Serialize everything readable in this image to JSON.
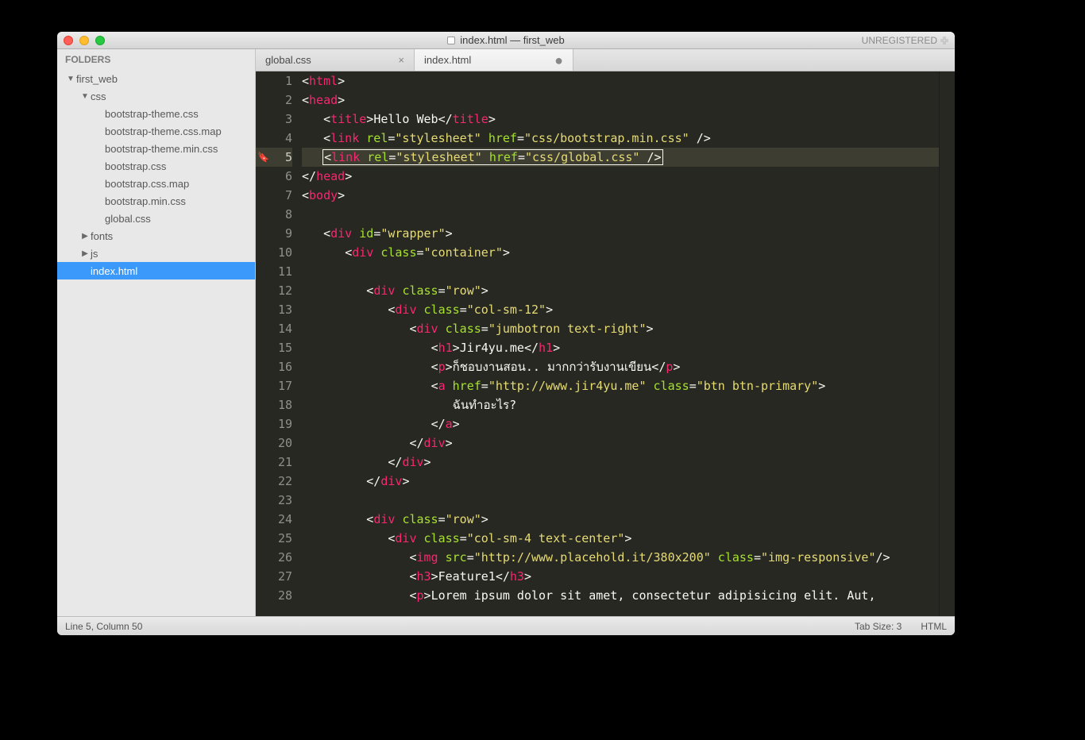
{
  "window": {
    "title": "index.html — first_web",
    "unregistered": "UNREGISTERED"
  },
  "sidebar": {
    "heading": "FOLDERS",
    "tree": [
      {
        "label": "first_web",
        "depth": 0,
        "arrow": "down",
        "sel": false
      },
      {
        "label": "css",
        "depth": 1,
        "arrow": "down",
        "sel": false
      },
      {
        "label": "bootstrap-theme.css",
        "depth": 2,
        "arrow": "",
        "sel": false
      },
      {
        "label": "bootstrap-theme.css.map",
        "depth": 2,
        "arrow": "",
        "sel": false
      },
      {
        "label": "bootstrap-theme.min.css",
        "depth": 2,
        "arrow": "",
        "sel": false
      },
      {
        "label": "bootstrap.css",
        "depth": 2,
        "arrow": "",
        "sel": false
      },
      {
        "label": "bootstrap.css.map",
        "depth": 2,
        "arrow": "",
        "sel": false
      },
      {
        "label": "bootstrap.min.css",
        "depth": 2,
        "arrow": "",
        "sel": false
      },
      {
        "label": "global.css",
        "depth": 2,
        "arrow": "",
        "sel": false
      },
      {
        "label": "fonts",
        "depth": 1,
        "arrow": "right",
        "sel": false
      },
      {
        "label": "js",
        "depth": 1,
        "arrow": "right",
        "sel": false
      },
      {
        "label": "index.html",
        "depth": 1,
        "arrow": "",
        "sel": true
      }
    ]
  },
  "tabs": [
    {
      "label": "global.css",
      "active": false,
      "modified": false
    },
    {
      "label": "index.html",
      "active": true,
      "modified": true
    }
  ],
  "code": {
    "highlighted_line": 5,
    "lines": [
      {
        "n": 1,
        "ind": 0,
        "tokens": [
          [
            "ang",
            "<"
          ],
          [
            "tag",
            "html"
          ],
          [
            "ang",
            ">"
          ]
        ]
      },
      {
        "n": 2,
        "ind": 0,
        "tokens": [
          [
            "ang",
            "<"
          ],
          [
            "tag",
            "head"
          ],
          [
            "ang",
            ">"
          ]
        ]
      },
      {
        "n": 3,
        "ind": 1,
        "tokens": [
          [
            "ang",
            "<"
          ],
          [
            "tag",
            "title"
          ],
          [
            "ang",
            ">"
          ],
          [
            "txt",
            "Hello Web"
          ],
          [
            "ang",
            "</"
          ],
          [
            "tag",
            "title"
          ],
          [
            "ang",
            ">"
          ]
        ]
      },
      {
        "n": 4,
        "ind": 1,
        "tokens": [
          [
            "ang",
            "<"
          ],
          [
            "tag",
            "link"
          ],
          [
            "txt",
            " "
          ],
          [
            "attr",
            "rel"
          ],
          [
            "punc",
            "="
          ],
          [
            "str",
            "\"stylesheet\""
          ],
          [
            "txt",
            " "
          ],
          [
            "attr",
            "href"
          ],
          [
            "punc",
            "="
          ],
          [
            "str",
            "\"css/bootstrap.min.css\""
          ],
          [
            "txt",
            " "
          ],
          [
            "ang",
            "/>"
          ]
        ]
      },
      {
        "n": 5,
        "ind": 1,
        "hl": true,
        "sel": true,
        "tokens": [
          [
            "ang",
            "<"
          ],
          [
            "tag",
            "link"
          ],
          [
            "txt",
            " "
          ],
          [
            "attr",
            "rel"
          ],
          [
            "punc",
            "="
          ],
          [
            "str",
            "\"stylesheet\""
          ],
          [
            "txt",
            " "
          ],
          [
            "attr",
            "href"
          ],
          [
            "punc",
            "="
          ],
          [
            "str",
            "\"css/global.css\""
          ],
          [
            "txt",
            " "
          ],
          [
            "ang",
            "/>"
          ]
        ]
      },
      {
        "n": 6,
        "ind": 0,
        "tokens": [
          [
            "ang",
            "</"
          ],
          [
            "tag",
            "head"
          ],
          [
            "ang",
            ">"
          ]
        ]
      },
      {
        "n": 7,
        "ind": 0,
        "tokens": [
          [
            "ang",
            "<"
          ],
          [
            "tag",
            "body"
          ],
          [
            "ang",
            ">"
          ]
        ]
      },
      {
        "n": 8,
        "ind": 0,
        "tokens": []
      },
      {
        "n": 9,
        "ind": 1,
        "tokens": [
          [
            "ang",
            "<"
          ],
          [
            "tag",
            "div"
          ],
          [
            "txt",
            " "
          ],
          [
            "attr",
            "id"
          ],
          [
            "punc",
            "="
          ],
          [
            "str",
            "\"wrapper\""
          ],
          [
            "ang",
            ">"
          ]
        ]
      },
      {
        "n": 10,
        "ind": 2,
        "tokens": [
          [
            "ang",
            "<"
          ],
          [
            "tag",
            "div"
          ],
          [
            "txt",
            " "
          ],
          [
            "attr",
            "class"
          ],
          [
            "punc",
            "="
          ],
          [
            "str",
            "\"container\""
          ],
          [
            "ang",
            ">"
          ]
        ]
      },
      {
        "n": 11,
        "ind": 0,
        "tokens": []
      },
      {
        "n": 12,
        "ind": 3,
        "tokens": [
          [
            "ang",
            "<"
          ],
          [
            "tag",
            "div"
          ],
          [
            "txt",
            " "
          ],
          [
            "attr",
            "class"
          ],
          [
            "punc",
            "="
          ],
          [
            "str",
            "\"row\""
          ],
          [
            "ang",
            ">"
          ]
        ]
      },
      {
        "n": 13,
        "ind": 4,
        "tokens": [
          [
            "ang",
            "<"
          ],
          [
            "tag",
            "div"
          ],
          [
            "txt",
            " "
          ],
          [
            "attr",
            "class"
          ],
          [
            "punc",
            "="
          ],
          [
            "str",
            "\"col-sm-12\""
          ],
          [
            "ang",
            ">"
          ]
        ]
      },
      {
        "n": 14,
        "ind": 5,
        "tokens": [
          [
            "ang",
            "<"
          ],
          [
            "tag",
            "div"
          ],
          [
            "txt",
            " "
          ],
          [
            "attr",
            "class"
          ],
          [
            "punc",
            "="
          ],
          [
            "str",
            "\"jumbotron text-right\""
          ],
          [
            "ang",
            ">"
          ]
        ]
      },
      {
        "n": 15,
        "ind": 6,
        "tokens": [
          [
            "ang",
            "<"
          ],
          [
            "tag",
            "h1"
          ],
          [
            "ang",
            ">"
          ],
          [
            "txt",
            "Jir4yu.me"
          ],
          [
            "ang",
            "</"
          ],
          [
            "tag",
            "h1"
          ],
          [
            "ang",
            ">"
          ]
        ]
      },
      {
        "n": 16,
        "ind": 6,
        "tokens": [
          [
            "ang",
            "<"
          ],
          [
            "tag",
            "p"
          ],
          [
            "ang",
            ">"
          ],
          [
            "txt",
            "ก็ชอบงานสอน.. มากกว่ารับงานเขียน"
          ],
          [
            "ang",
            "</"
          ],
          [
            "tag",
            "p"
          ],
          [
            "ang",
            ">"
          ]
        ]
      },
      {
        "n": 17,
        "ind": 6,
        "tokens": [
          [
            "ang",
            "<"
          ],
          [
            "tag",
            "a"
          ],
          [
            "txt",
            " "
          ],
          [
            "attr",
            "href"
          ],
          [
            "punc",
            "="
          ],
          [
            "str",
            "\"http://www.jir4yu.me\""
          ],
          [
            "txt",
            " "
          ],
          [
            "attr",
            "class"
          ],
          [
            "punc",
            "="
          ],
          [
            "str",
            "\"btn btn-primary\""
          ],
          [
            "ang",
            ">"
          ]
        ]
      },
      {
        "n": 18,
        "ind": 7,
        "tokens": [
          [
            "txt",
            "ฉันทำอะไร?"
          ]
        ]
      },
      {
        "n": 19,
        "ind": 6,
        "tokens": [
          [
            "ang",
            "</"
          ],
          [
            "tag",
            "a"
          ],
          [
            "ang",
            ">"
          ]
        ]
      },
      {
        "n": 20,
        "ind": 5,
        "tokens": [
          [
            "ang",
            "</"
          ],
          [
            "tag",
            "div"
          ],
          [
            "ang",
            ">"
          ]
        ]
      },
      {
        "n": 21,
        "ind": 4,
        "tokens": [
          [
            "ang",
            "</"
          ],
          [
            "tag",
            "div"
          ],
          [
            "ang",
            ">"
          ]
        ]
      },
      {
        "n": 22,
        "ind": 3,
        "tokens": [
          [
            "ang",
            "</"
          ],
          [
            "tag",
            "div"
          ],
          [
            "ang",
            ">"
          ]
        ]
      },
      {
        "n": 23,
        "ind": 0,
        "tokens": []
      },
      {
        "n": 24,
        "ind": 3,
        "tokens": [
          [
            "ang",
            "<"
          ],
          [
            "tag",
            "div"
          ],
          [
            "txt",
            " "
          ],
          [
            "attr",
            "class"
          ],
          [
            "punc",
            "="
          ],
          [
            "str",
            "\"row\""
          ],
          [
            "ang",
            ">"
          ]
        ]
      },
      {
        "n": 25,
        "ind": 4,
        "tokens": [
          [
            "ang",
            "<"
          ],
          [
            "tag",
            "div"
          ],
          [
            "txt",
            " "
          ],
          [
            "attr",
            "class"
          ],
          [
            "punc",
            "="
          ],
          [
            "str",
            "\"col-sm-4 text-center\""
          ],
          [
            "ang",
            ">"
          ]
        ]
      },
      {
        "n": 26,
        "ind": 5,
        "tokens": [
          [
            "ang",
            "<"
          ],
          [
            "tag",
            "img"
          ],
          [
            "txt",
            " "
          ],
          [
            "attr",
            "src"
          ],
          [
            "punc",
            "="
          ],
          [
            "str",
            "\"http://www.placehold.it/380x200\""
          ],
          [
            "txt",
            " "
          ],
          [
            "attr",
            "class"
          ],
          [
            "punc",
            "="
          ],
          [
            "str",
            "\"img-responsive\""
          ],
          [
            "ang",
            "/>"
          ]
        ]
      },
      {
        "n": 27,
        "ind": 5,
        "tokens": [
          [
            "ang",
            "<"
          ],
          [
            "tag",
            "h3"
          ],
          [
            "ang",
            ">"
          ],
          [
            "txt",
            "Feature1"
          ],
          [
            "ang",
            "</"
          ],
          [
            "tag",
            "h3"
          ],
          [
            "ang",
            ">"
          ]
        ]
      },
      {
        "n": 28,
        "ind": 5,
        "tokens": [
          [
            "ang",
            "<"
          ],
          [
            "tag",
            "p"
          ],
          [
            "ang",
            ">"
          ],
          [
            "txt",
            "Lorem ipsum dolor sit amet, consectetur adipisicing elit. Aut,"
          ]
        ]
      }
    ]
  },
  "status": {
    "position": "Line 5, Column 50",
    "tab_size": "Tab Size: 3",
    "syntax": "HTML"
  }
}
